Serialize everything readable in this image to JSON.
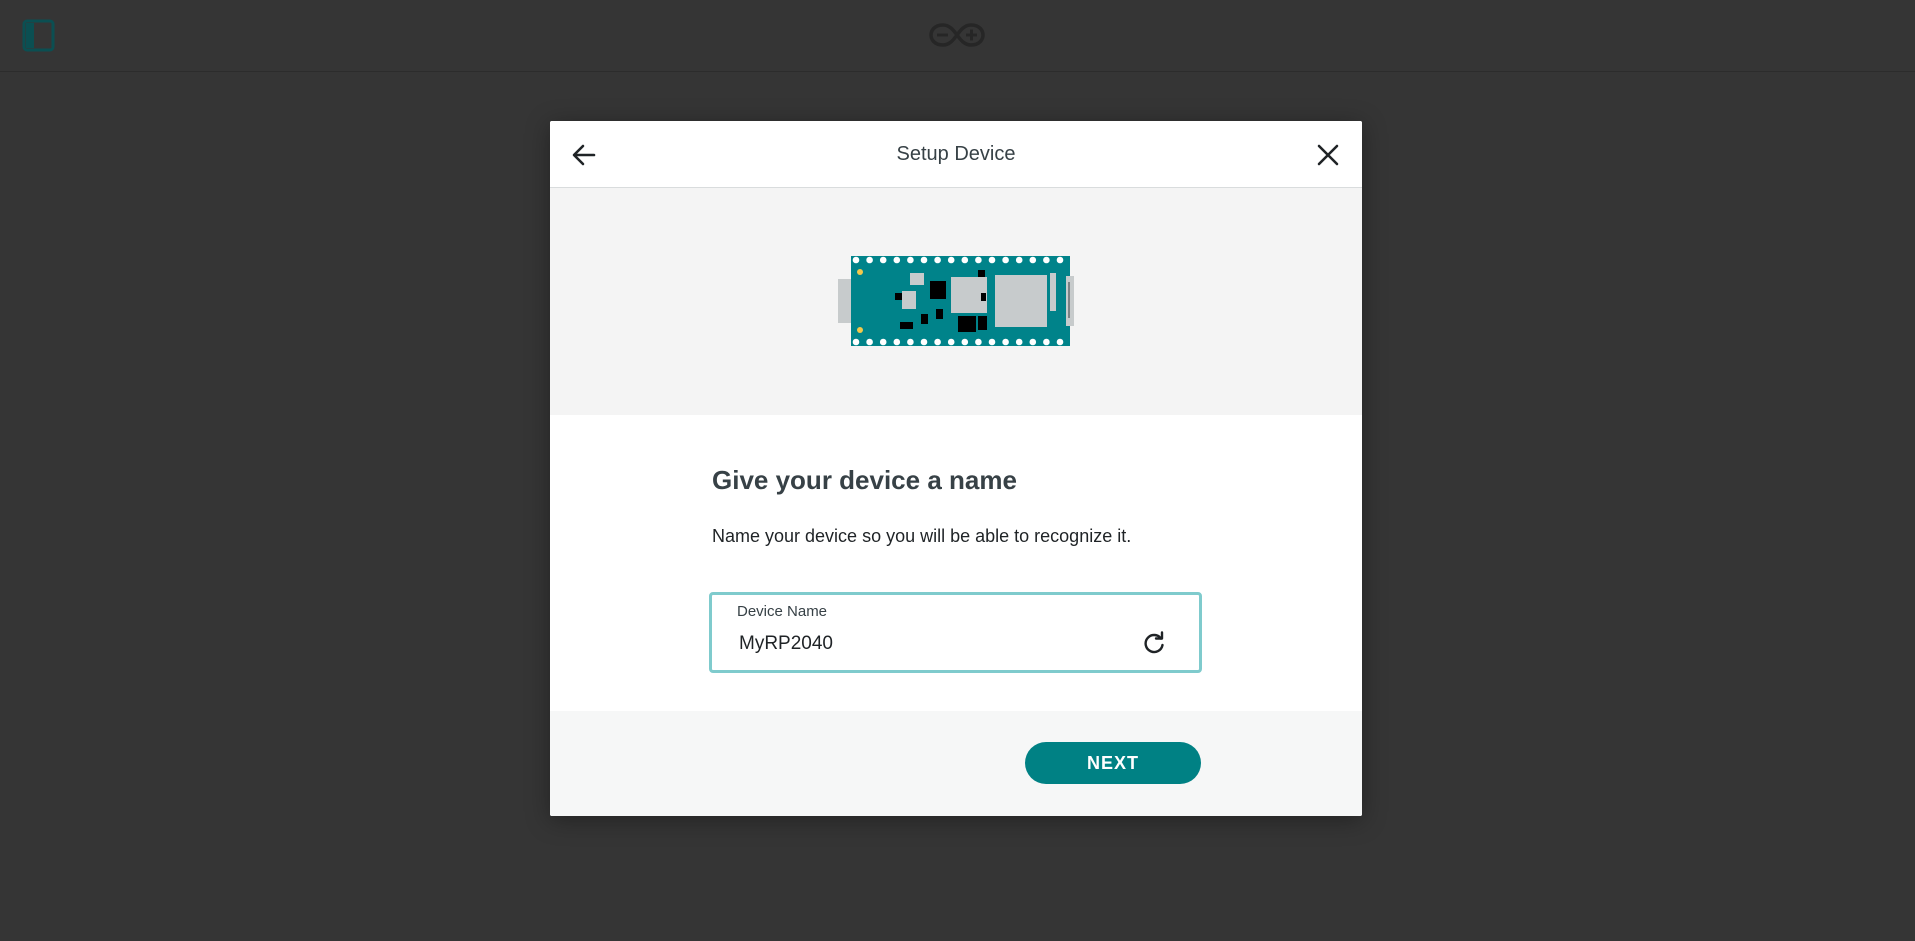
{
  "app": {
    "logo_icon": "arduino-infinity-logo-icon",
    "sidebar_toggle_icon": "sidebar-toggle-icon"
  },
  "modal": {
    "title": "Setup Device",
    "back_icon": "arrow-left-icon",
    "close_icon": "close-icon",
    "illustration": "arduino-nano-rp2040-board",
    "heading": "Give your device a name",
    "description": "Name your device so you will be able to recognize it.",
    "device_name_field": {
      "label": "Device Name",
      "value": "MyRP2040",
      "refresh_icon": "refresh-icon"
    },
    "next_label": "NEXT"
  },
  "colors": {
    "backdrop": "#353535",
    "accent": "#008184",
    "field_focus_border": "#7fcbcd",
    "board_pcb": "#00838a",
    "text_dark": "#374146"
  }
}
